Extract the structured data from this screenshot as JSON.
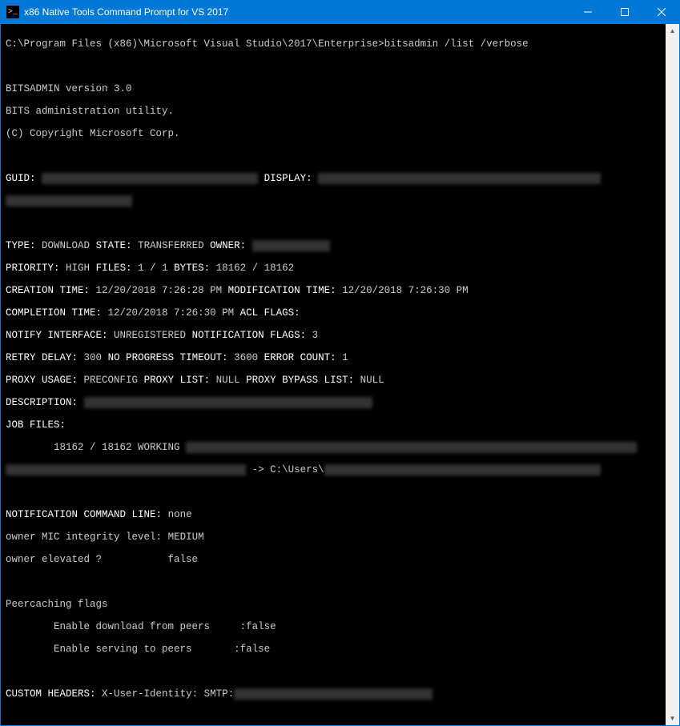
{
  "window": {
    "title": "x86 Native Tools Command Prompt for VS 2017",
    "icon_label": "cmd-icon"
  },
  "terminal": {
    "prompt_path": "C:\\Program Files (x86)\\Microsoft Visual Studio\\2017\\Enterprise>",
    "command": "bitsadmin /list /verbose",
    "banner": {
      "l1": "BITSADMIN version 3.0",
      "l2": "BITS administration utility.",
      "l3": "(C) Copyright Microsoft Corp."
    },
    "labels": {
      "guid": "GUID:",
      "display": "DISPLAY:",
      "type": "TYPE:",
      "state": "STATE:",
      "owner": "OWNER:",
      "priority": "PRIORITY:",
      "files": "FILES:",
      "bytes": "BYTES:",
      "creation": "CREATION TIME:",
      "modification": "MODIFICATION TIME:",
      "completion": "COMPLETION TIME:",
      "aclflags": "ACL FLAGS:",
      "notify_iface": "NOTIFY INTERFACE:",
      "notify_flags": "NOTIFICATION FLAGS:",
      "retry_delay": "RETRY DELAY:",
      "noprogress": "NO PROGRESS TIMEOUT:",
      "errcount": "ERROR COUNT:",
      "proxy_usage": "PROXY USAGE:",
      "proxy_list": "PROXY LIST:",
      "proxy_bypass": "PROXY BYPASS LIST:",
      "description": "DESCRIPTION:",
      "job_files": "JOB FILES:",
      "notif_cmd": "NOTIFICATION COMMAND LINE:",
      "mic": "owner MIC integrity level:",
      "elevated": "owner elevated ?",
      "peercache_hdr": "Peercaching flags",
      "peercache_dl": "Enable download from peers",
      "peercache_sv": "Enable serving to peers",
      "custom_hdr": "CUSTOM HEADERS:"
    },
    "values": {
      "type": "DOWNLOAD",
      "state": "TRANSFERRED",
      "priority": "HIGH",
      "files": "1 / 1",
      "bytes": "18162 / 18162",
      "creation": "12/20/2018 7:26:28 PM",
      "modification": "12/20/2018 7:26:30 PM",
      "completion": "12/20/2018 7:26:30 PM",
      "notify_iface": "UNREGISTERED",
      "notify_flags": "3",
      "retry_delay": "300",
      "noprogress": "3600",
      "errcount": "1",
      "proxy_usage": "PRECONFIG",
      "proxy_list": "NULL",
      "proxy_bypass": "NULL",
      "jobfile_bytes": "18162 / 18162 WORKING",
      "jobfile_arrow": " -> C:\\Users\\",
      "notif_cmd": "none",
      "mic": "MEDIUM",
      "elevated": "false",
      "peercache_dl": ":false",
      "peercache_sv": ":false",
      "custom_hdr_key": "X-User-Identity: SMTP:"
    },
    "redacted": {
      "guid": "XXXXXXXX-XXXX-XXXX-XXXX-XXXXXXXXXXXX",
      "display1": "Xxxxxxxxx Xxxxxxx Xxxxxxx Xxxxxxx Xxxx xXxXXXxx",
      "display2": "xxXXxxxXXXxXXXxXXXXxx",
      "owner": "XXXXXXXxxxxxX",
      "description": "Xxxxxxxxx Xxxxxxx Xxxxxxx Xxxxxxx Xxxx Xxxxxxxxx",
      "jobfile_url": "xxxxx://xxxxxxx.xxxxxxxxx.xxx/XXX/xXXXXXXX-xXXX-Xxxx-XXxX-XXx/xXXxXXXXXX/XX",
      "jobfile_url2": "xXXxx-xxxX-XxXX-XXXX-XXXXXXXXXXXX/xx.xxX",
      "jobfile_dest": "xxxxXXXxxXxxxXxxxxx/Xxxxxxxxx/Xx/xxxxXxxxX.xxX",
      "smtp": "xxxxxxxxxxxxxxxxxxxxx@xxxxxxx.xxx"
    }
  }
}
